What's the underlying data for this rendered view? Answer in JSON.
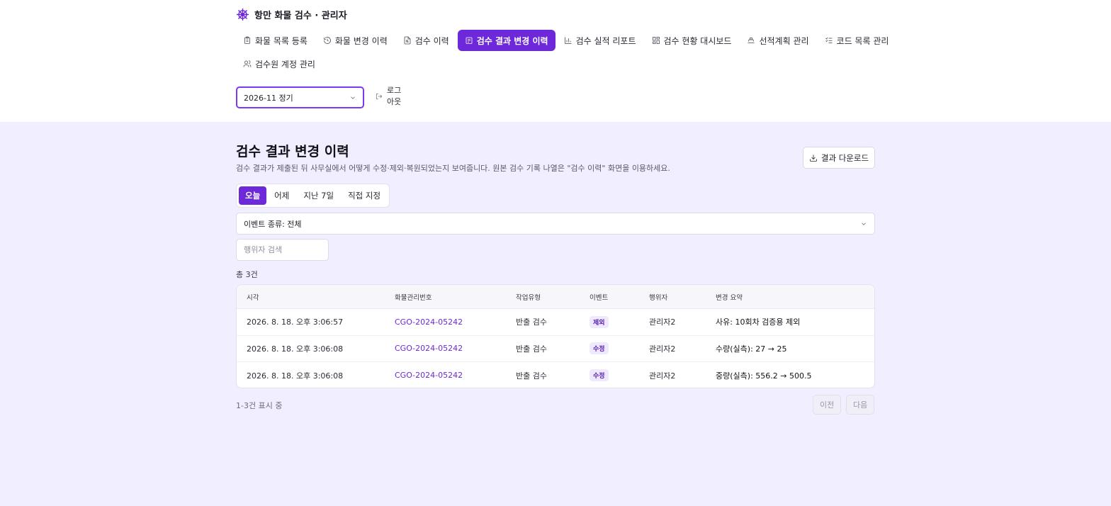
{
  "app": {
    "title": "항만 화물 검수 · 관리자"
  },
  "nav": {
    "items": [
      {
        "label": "화물 목록 등록",
        "icon": "clipboard-icon"
      },
      {
        "label": "화물 변경 이력",
        "icon": "history-icon"
      },
      {
        "label": "검수 이력",
        "icon": "file-search-icon"
      },
      {
        "label": "검수 결과 변경 이력",
        "icon": "clipboard-list-icon",
        "active": true
      },
      {
        "label": "검수 실적 리포트",
        "icon": "bar-chart-icon"
      },
      {
        "label": "검수 현황 대시보드",
        "icon": "dashboard-icon"
      },
      {
        "label": "선적계획 관리",
        "icon": "ship-icon"
      },
      {
        "label": "코드 목록 관리",
        "icon": "list-check-icon"
      },
      {
        "label": "검수원 계정 관리",
        "icon": "users-icon"
      }
    ]
  },
  "period_select": {
    "value": "2026-11 정기"
  },
  "logout": {
    "label": "로그 아웃"
  },
  "page": {
    "title": "검수 결과 변경 이력",
    "description": "검수 결과가 제출된 뒤 사무실에서 어떻게 수정·제외·복원되었는지 보여줍니다. 원본 검수 기록 나열은 \"검수 이력\" 화면을 이용하세요.",
    "download_label": "결과 다운로드"
  },
  "date_filter": {
    "options": [
      "오늘",
      "어제",
      "지난 7일",
      "직접 지정"
    ],
    "selected": "오늘"
  },
  "event_filter": {
    "value": "이벤트 종류: 전체"
  },
  "actor_search": {
    "placeholder": "행위자 검색",
    "value": ""
  },
  "total": "총 3건",
  "table": {
    "headers": [
      "시각",
      "화물관리번호",
      "작업유형",
      "이벤트",
      "행위자",
      "변경 요약"
    ],
    "rows": [
      {
        "time": "2026. 8. 18. 오후 3:06:57",
        "cargo_no": "CGO-2024-05242",
        "work_type": "반출 검수",
        "event": "제외",
        "actor": "관리자2",
        "summary": "사유: 10회차 검증용 제외"
      },
      {
        "time": "2026. 8. 18. 오후 3:06:08",
        "cargo_no": "CGO-2024-05242",
        "work_type": "반출 검수",
        "event": "수정",
        "actor": "관리자2",
        "summary": "수량(실측): 27 → 25"
      },
      {
        "time": "2026. 8. 18. 오후 3:06:08",
        "cargo_no": "CGO-2024-05242",
        "work_type": "반출 검수",
        "event": "수정",
        "actor": "관리자2",
        "summary": "중량(실측): 556.2 → 500.5"
      }
    ]
  },
  "pagination": {
    "info": "1-3건 표시 중",
    "prev_label": "이전",
    "next_label": "다음"
  },
  "colors": {
    "accent": "#6d28d9",
    "background": "#f1efff",
    "badge_bg": "#efe9fd"
  }
}
